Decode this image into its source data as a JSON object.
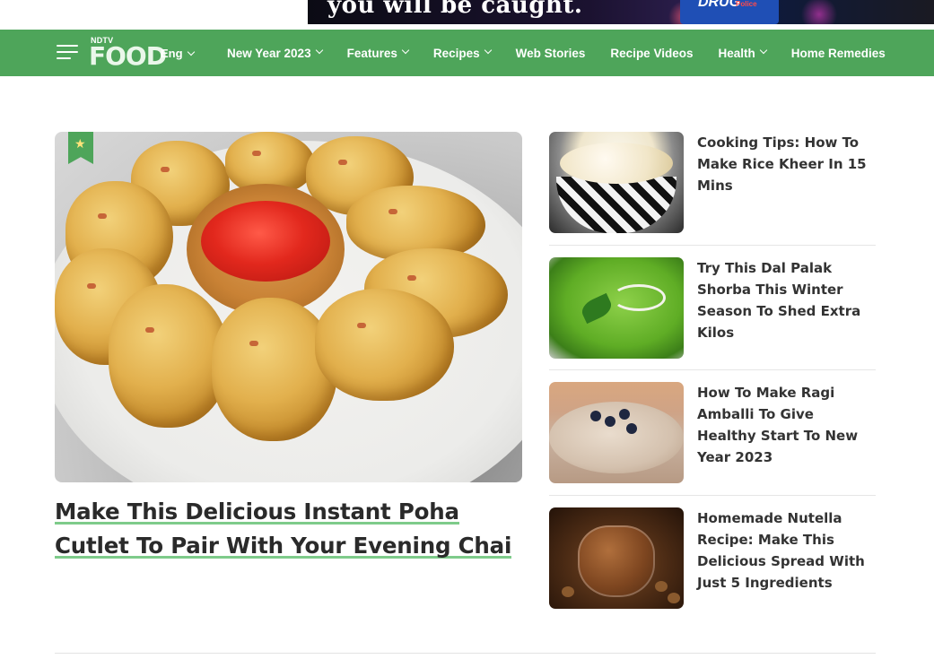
{
  "ad": {
    "headline": "you will be caught.",
    "van_text": "DRUG",
    "van_sub": "Police"
  },
  "nav": {
    "logo_top": "NDTV",
    "logo_main": "FOOD",
    "lang": "Eng",
    "items": [
      {
        "label": "New Year 2023",
        "dropdown": true
      },
      {
        "label": "Features",
        "dropdown": true
      },
      {
        "label": "Recipes",
        "dropdown": true
      },
      {
        "label": "Web Stories",
        "dropdown": false
      },
      {
        "label": "Recipe Videos",
        "dropdown": false
      },
      {
        "label": "Health",
        "dropdown": true
      },
      {
        "label": "Home Remedies",
        "dropdown": false
      }
    ],
    "color": "#4ea55a"
  },
  "feature": {
    "title": "Make This Delicious Instant Poha Cutlet To Pair With Your Evening Chai",
    "badge_icon": "star-icon",
    "underline_color": "#7ecb8a"
  },
  "side": [
    {
      "title": "Cooking Tips: How To Make Rice Kheer In 15 Mins"
    },
    {
      "title": "Try This Dal Palak Shorba This Winter Season To Shed Extra Kilos"
    },
    {
      "title": "How To Make Ragi Amballi To Give Healthy Start To New Year 2023"
    },
    {
      "title": "Homemade Nutella Recipe: Make This Delicious Spread With Just 5 Ingredients"
    }
  ]
}
